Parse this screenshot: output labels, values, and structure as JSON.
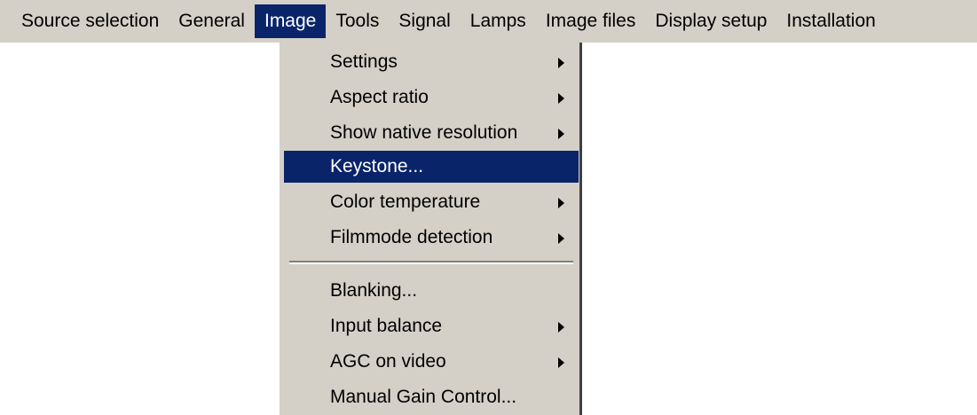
{
  "menubar": {
    "items": [
      {
        "label": "Source selection"
      },
      {
        "label": "General"
      },
      {
        "label": "Image"
      },
      {
        "label": "Tools"
      },
      {
        "label": "Signal"
      },
      {
        "label": "Lamps"
      },
      {
        "label": "Image files"
      },
      {
        "label": "Display setup"
      },
      {
        "label": "Installation"
      }
    ],
    "active": "Image"
  },
  "image_menu": {
    "items": [
      {
        "label": "Settings",
        "submenu_icon": "triangle-right-icon"
      },
      {
        "label": "Aspect ratio",
        "submenu_icon": "triangle-right-icon"
      },
      {
        "label": "Show native resolution",
        "submenu_icon": "triangle-right-icon"
      },
      {
        "label": "Keystone..."
      },
      {
        "label": "Color temperature",
        "submenu_icon": "triangle-right-icon"
      },
      {
        "label": "Filmmode detection",
        "submenu_icon": "triangle-right-icon"
      },
      {
        "label": "Blanking..."
      },
      {
        "label": "Input balance",
        "submenu_icon": "triangle-right-icon"
      },
      {
        "label": "AGC on video",
        "submenu_icon": "triangle-right-icon"
      },
      {
        "label": "Manual Gain Control..."
      }
    ],
    "highlighted": "Keystone..."
  },
  "colors": {
    "menu_background": "#d4d0c8",
    "highlight": "#0a246a",
    "highlight_text": "#ffffff"
  }
}
